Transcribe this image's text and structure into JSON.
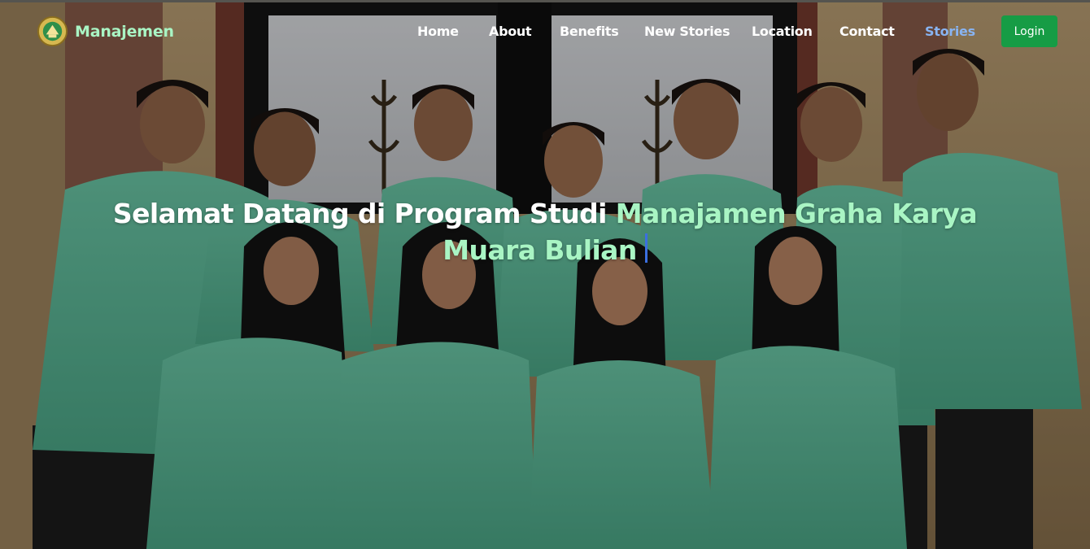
{
  "brand": {
    "name": "Manajemen",
    "logo_icon": "university-crest-icon"
  },
  "nav": {
    "items": [
      {
        "label": "Home",
        "active": false
      },
      {
        "label": "About",
        "active": false
      },
      {
        "label": "Benefits",
        "active": false
      },
      {
        "label": "New Stories",
        "active": false
      },
      {
        "label": "Location",
        "active": false
      },
      {
        "label": "Contact",
        "active": false
      },
      {
        "label": "Stories",
        "active": true
      }
    ],
    "login_label": "Login"
  },
  "hero": {
    "headline_plain": "Selamat Datang di Program Studi ",
    "headline_highlight": "Manajamen Graha Karya Muara Bulian",
    "background_image": "group-photo-students-in-green-blazers"
  },
  "colors": {
    "accent_text": "#a9f5c4",
    "active_nav": "#88b4f2",
    "login_button": "#169c45",
    "cursor": "#3b6fe0",
    "blazer": "#5fbf9e"
  }
}
